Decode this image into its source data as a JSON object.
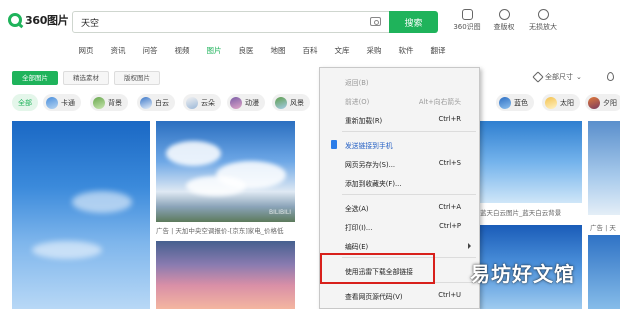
{
  "header": {
    "logo_text": "360图片",
    "search_value": "天空",
    "search_button": "搜索",
    "tools": [
      {
        "label": "360识图",
        "icon": "scan-icon"
      },
      {
        "label": "查版权",
        "icon": "copyright-icon"
      },
      {
        "label": "无损放大",
        "icon": "magnify-icon"
      }
    ]
  },
  "nav": {
    "items": [
      "网页",
      "资讯",
      "问答",
      "视频",
      "图片",
      "良医",
      "地图",
      "百科",
      "文库",
      "采购",
      "软件",
      "翻译"
    ],
    "active": "图片"
  },
  "filters": {
    "buttons": [
      "全部图片",
      "精选素材",
      "版权图片"
    ],
    "size_label": "全部尺寸"
  },
  "tags": [
    "全部",
    "卡通",
    "背景",
    "白云",
    "云朵",
    "动漫",
    "风景",
    "蓝色",
    "太阳",
    "夕阳"
  ],
  "captions": {
    "img2": "广告 | 天加中央空调报价-[京东]家电_价格低",
    "img2_watermark": "BILIBILI",
    "img4": "蓝天白云图片_蓝天白云背景",
    "img6": "广告 | 天"
  },
  "context_menu": {
    "items": [
      {
        "label": "返回(B)",
        "shortcut": "",
        "state": "disabled"
      },
      {
        "label": "前进(O)",
        "shortcut": "Alt+向右箭头",
        "state": "disabled"
      },
      {
        "label": "重新加载(R)",
        "shortcut": "Ctrl+R",
        "state": "normal"
      },
      {
        "label": "发送链接到手机",
        "shortcut": "",
        "state": "link"
      },
      {
        "label": "网页另存为(S)...",
        "shortcut": "Ctrl+S",
        "state": "normal"
      },
      {
        "label": "添加到收藏夹(F)...",
        "shortcut": "",
        "state": "normal"
      },
      {
        "label": "全选(A)",
        "shortcut": "Ctrl+A",
        "state": "normal"
      },
      {
        "label": "打印(I)...",
        "shortcut": "Ctrl+P",
        "state": "normal"
      },
      {
        "label": "编码(E)",
        "shortcut": "",
        "state": "submenu"
      },
      {
        "label": "使用迅雷下载全部链接",
        "shortcut": "",
        "state": "normal"
      },
      {
        "label": "查看网页源代码(V)",
        "shortcut": "Ctrl+U",
        "state": "normal"
      }
    ]
  },
  "site_watermark": "易坊好文馆",
  "colors": {
    "accent": "#1fb35b",
    "highlight_box": "#d8201b",
    "menu_link": "#2560c4"
  }
}
